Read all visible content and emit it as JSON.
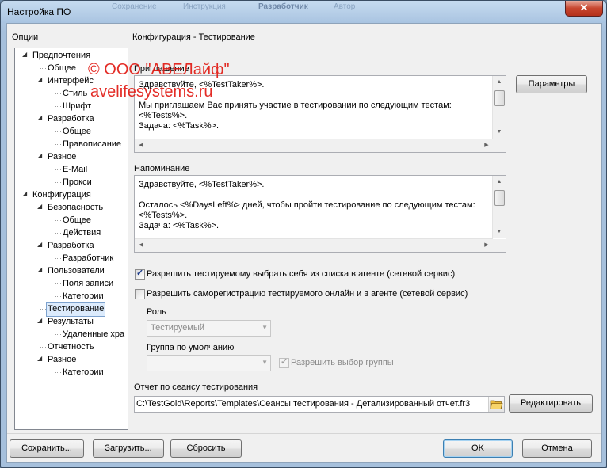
{
  "window": {
    "title": "Настройка ПО",
    "close_glyph": "✕",
    "ghost_tabs": [
      "Сохранение",
      "Инструкция",
      "Разработчик",
      "Автор"
    ]
  },
  "left_panel": {
    "label": "Опции",
    "tree": [
      {
        "label": "Предпочтения",
        "level": 0
      },
      {
        "label": "Общее",
        "level": 1
      },
      {
        "label": "Интерфейс",
        "level": 1
      },
      {
        "label": "Стиль",
        "level": 2
      },
      {
        "label": "Шрифт",
        "level": 2
      },
      {
        "label": "Разработка",
        "level": 1
      },
      {
        "label": "Общее",
        "level": 2
      },
      {
        "label": "Правописание",
        "level": 2
      },
      {
        "label": "Разное",
        "level": 1
      },
      {
        "label": "E-Mail",
        "level": 2
      },
      {
        "label": "Прокси",
        "level": 2
      },
      {
        "label": "Конфигурация",
        "level": 0
      },
      {
        "label": "Безопасность",
        "level": 1
      },
      {
        "label": "Общее",
        "level": 2
      },
      {
        "label": "Действия",
        "level": 2
      },
      {
        "label": "Разработка",
        "level": 1
      },
      {
        "label": "Разработчик",
        "level": 2
      },
      {
        "label": "Пользователи",
        "level": 1
      },
      {
        "label": "Поля записи",
        "level": 2
      },
      {
        "label": "Категории",
        "level": 2
      },
      {
        "label": "Тестирование",
        "level": 1,
        "selected": true
      },
      {
        "label": "Результаты",
        "level": 1
      },
      {
        "label": "Удаленные хра",
        "level": 2
      },
      {
        "label": "Отчетность",
        "level": 1
      },
      {
        "label": "Разное",
        "level": 1
      },
      {
        "label": "Категории",
        "level": 2
      }
    ]
  },
  "right_panel": {
    "section_title": "Конфигурация - Тестирование",
    "invitation": {
      "label": "Приглашение",
      "text": "Здравствуйте, <%TestTaker%>.\n\nМы приглашаем Вас принять участие в тестировании по следующим тестам:\n<%Tests%>.\nЗадача: <%Task%>."
    },
    "params_button": "Параметры",
    "reminder": {
      "label": "Напоминание",
      "text": "Здравствуйте, <%TestTaker%>.\n\nОсталось <%DaysLeft%> дней, чтобы пройти тестирование по следующим тестам:\n<%Tests%>.\nЗадача: <%Task%>."
    },
    "allow_select_self": {
      "label": "Разрешить тестируемому выбрать себя из списка в агенте (сетевой сервис)",
      "checked": true
    },
    "allow_self_registration": {
      "label": "Разрешить саморегистрацию тестируемого онлайн и в агенте (сетевой сервис)",
      "checked": false
    },
    "role": {
      "label": "Роль",
      "value": "Тестируемый"
    },
    "default_group": {
      "label": "Группа по умолчанию",
      "value": ""
    },
    "allow_group_choice": {
      "label": "Разрешить выбор группы",
      "checked": true
    },
    "report": {
      "label": "Отчет по сеансу тестирования",
      "path": "C:\\TestGold\\Reports\\Templates\\Сеансы тестирования - Детализированный отчет.fr3",
      "edit_button": "Редактировать"
    }
  },
  "watermark": {
    "line1": "© ООО \"АВЕЛайф\"",
    "line2": "avelifesystems.ru"
  },
  "bottom": {
    "save": "Сохранить...",
    "load": "Загрузить...",
    "reset": "Сбросить",
    "ok": "OK",
    "cancel": "Отмена"
  },
  "icons": {
    "close": "close-icon",
    "folder": "folder-open-icon",
    "expand": "tree-expand-icon"
  },
  "colors": {
    "title_bar": "#b9d1ea",
    "close_button": "#c7452e",
    "selection": "#dcebfc",
    "watermark": "#e1160f"
  }
}
